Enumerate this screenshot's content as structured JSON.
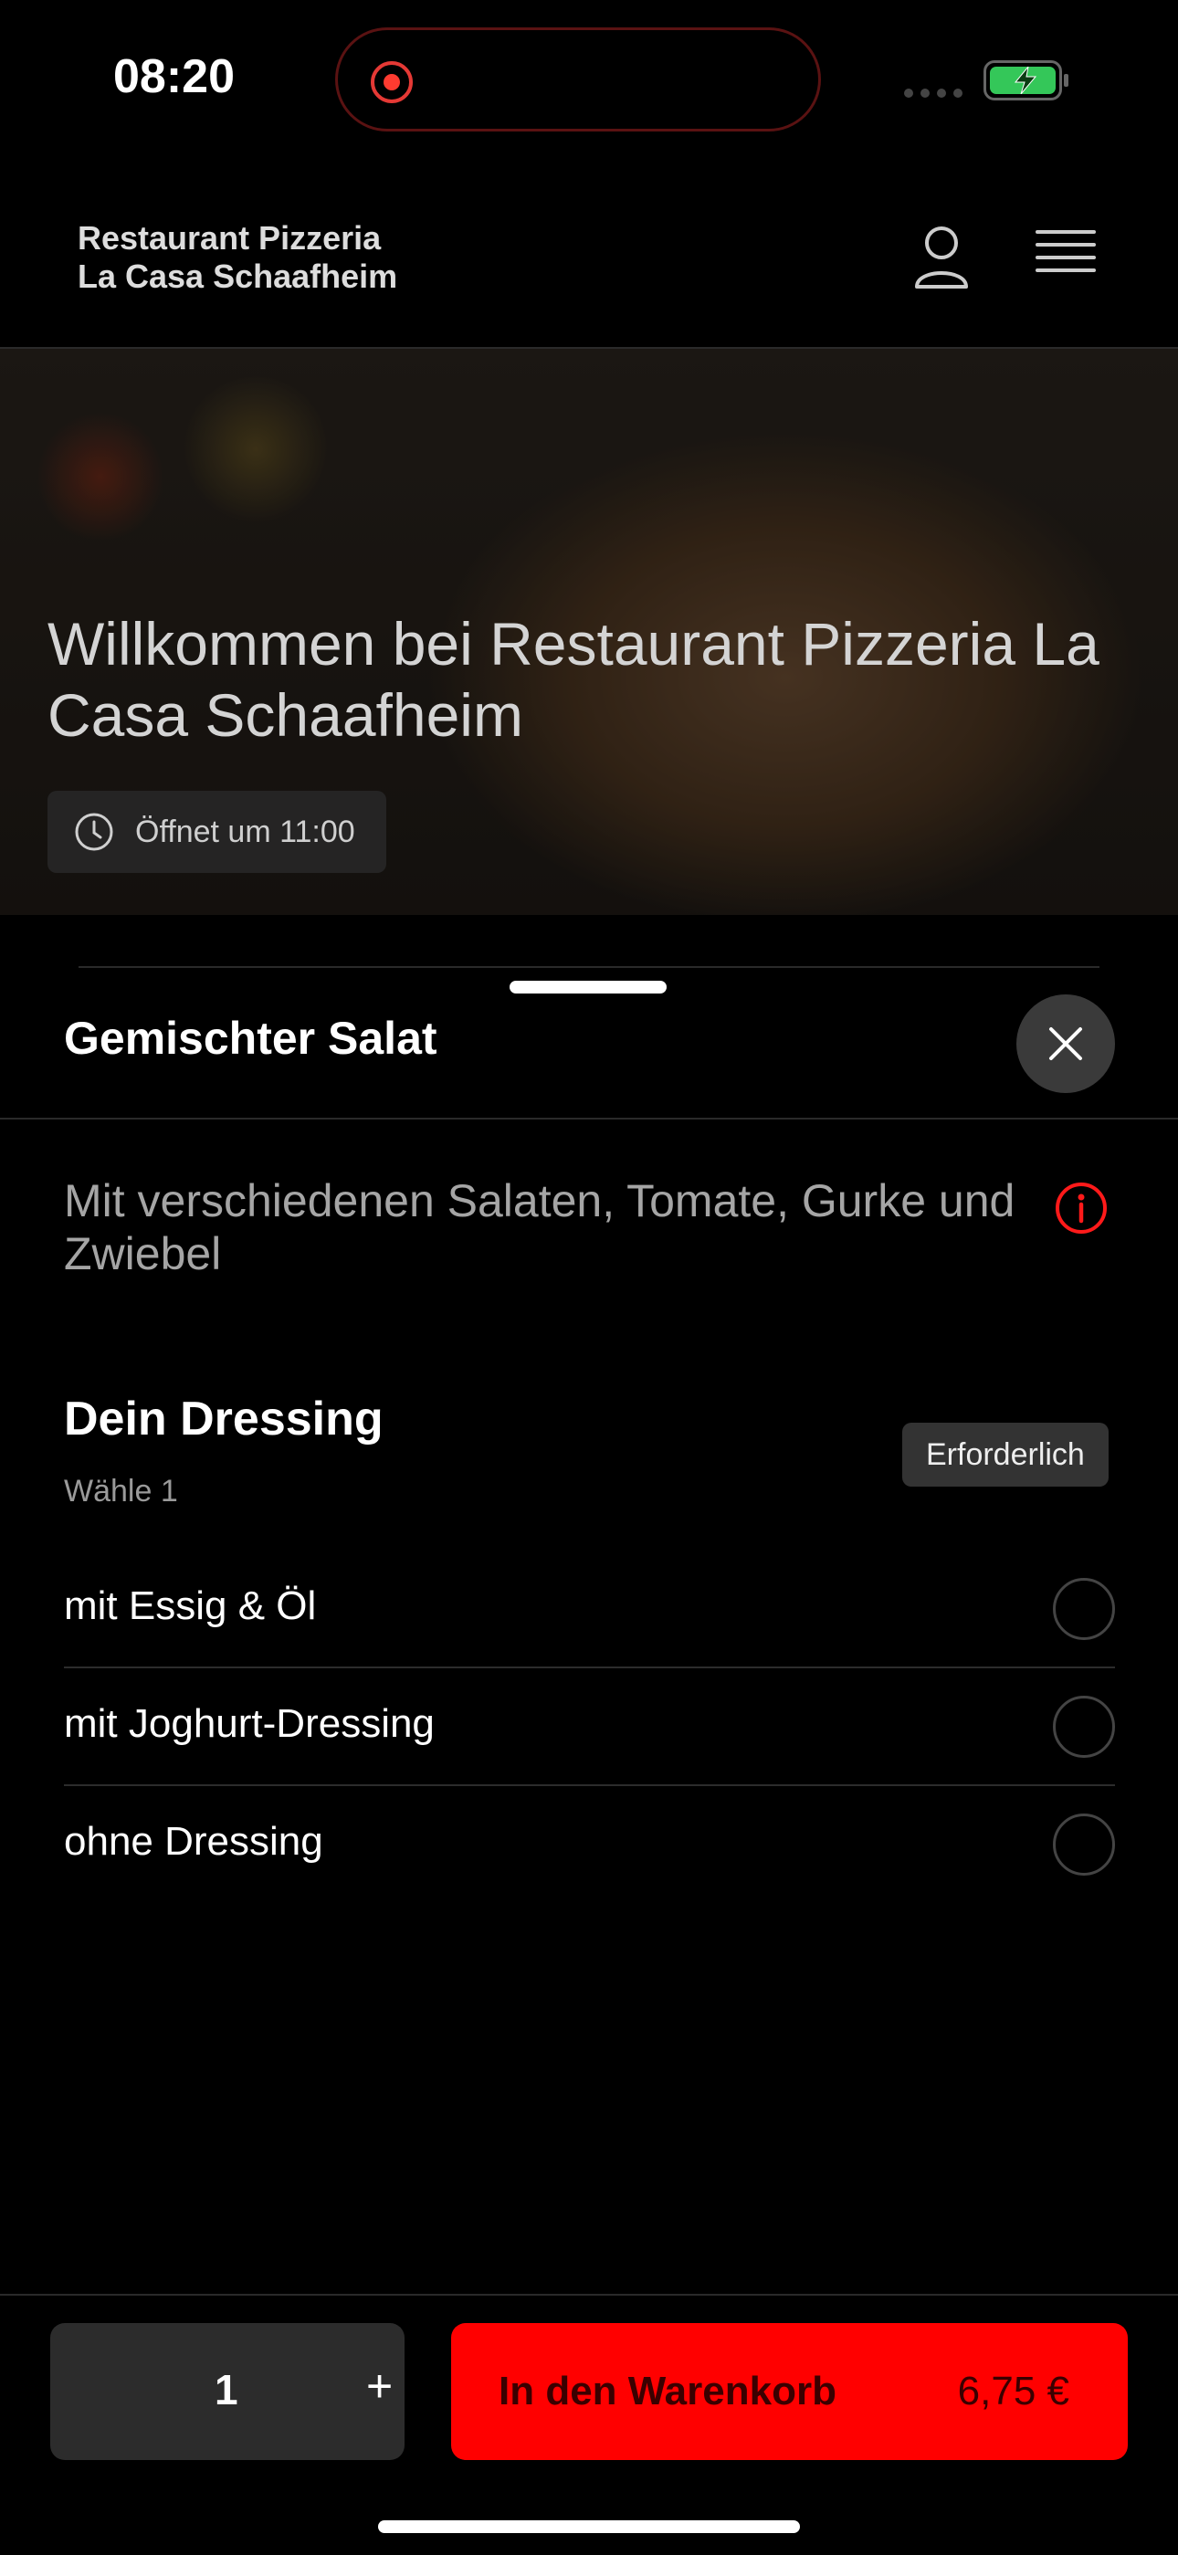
{
  "status": {
    "time": "08:20"
  },
  "header": {
    "brand_line1": "Restaurant Pizzeria",
    "brand_line2": "La Casa Schaafheim"
  },
  "hero": {
    "title": "Willkommen bei Restaurant Pizzeria La Casa Schaafheim",
    "hours": "Öffnet um 11:00"
  },
  "item": {
    "title": "Gemischter Salat",
    "description": "Mit verschiedenen Salaten, Tomate, Gurke und Zwiebel"
  },
  "dressing": {
    "title": "Dein Dressing",
    "subtitle": "Wähle 1",
    "badge": "Erforderlich",
    "options": [
      {
        "label": "mit Essig & Öl",
        "selected": false
      },
      {
        "label": "mit Joghurt-Dressing",
        "selected": false
      },
      {
        "label": "ohne Dressing",
        "selected": false
      }
    ]
  },
  "footer": {
    "quantity": "1",
    "plus": "+",
    "cart_label": "In den Warenkorb",
    "price": "6,75 €"
  },
  "colors": {
    "accent": "#ff0000",
    "background": "#000000"
  }
}
